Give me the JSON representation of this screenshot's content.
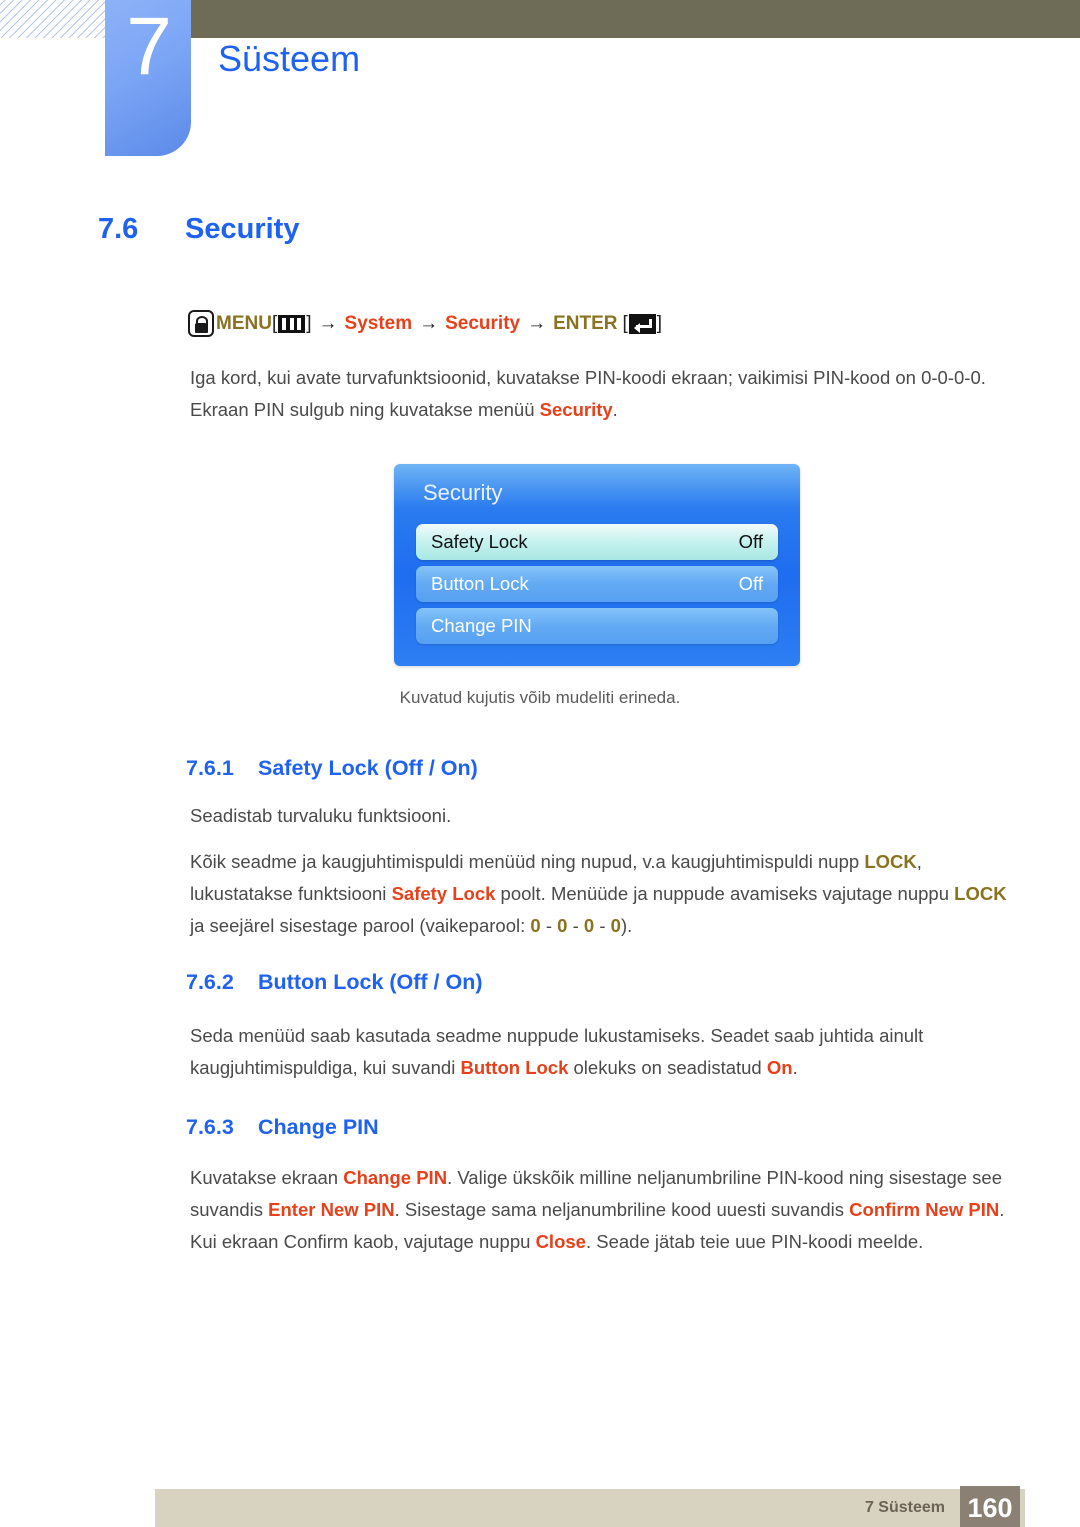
{
  "header": {
    "chapter_number": "7",
    "chapter_title": "Süsteem"
  },
  "section": {
    "number": "7.6",
    "title": "Security"
  },
  "menu_path": {
    "hand_icon": "hand-press-icon",
    "menu_label": "MENU",
    "bracket_open": "[",
    "menubars_icon": "menu-bars-icon",
    "bracket_close": "]",
    "arrow": "→",
    "step_system": "System",
    "step_security": "Security",
    "enter_label": "ENTER",
    "enter_icon": "enter-key-icon"
  },
  "intro": {
    "line1_part1": "Iga kord, kui avate turvafunktsioonid, kuvatakse PIN-koodi ekraan; vaikimisi PIN-kood on 0-0-0-0. Ekraan PIN sulgub ning kuvatakse menüü ",
    "line1_highlight": "Security",
    "line1_part2": "."
  },
  "osd": {
    "title": "Security",
    "rows": [
      {
        "label": "Safety Lock",
        "value": "Off",
        "selected": true
      },
      {
        "label": "Button Lock",
        "value": "Off",
        "selected": false
      },
      {
        "label": "Change PIN",
        "value": "",
        "selected": false
      }
    ]
  },
  "osd_caption": "Kuvatud kujutis võib mudeliti erineda.",
  "subsections": [
    {
      "number": "7.6.1",
      "title": "Safety Lock (Off / On)",
      "paragraphs": [
        {
          "text": "Seadistab turvaluku funktsiooni."
        }
      ],
      "long_paragraph": {
        "p1": "Kõik seadme ja kaugjuhtimispuldi menüüd ning nupud, v.a kaugjuhtimispuldi nupp ",
        "h1": "LOCK",
        "p2": ", lukustatakse funktsiooni ",
        "h2": "Safety Lock",
        "p3": " poolt. Menüüde ja nuppude avamiseks vajutage nuppu ",
        "h3": "LOCK",
        "p4": " ja seejärel sisestage parool (vaikeparool: ",
        "h4": "0",
        "p5": " - ",
        "h5": "0",
        "p6": " - ",
        "h6": "0",
        "p7": " - ",
        "h7": "0",
        "p8": ")."
      }
    },
    {
      "number": "7.6.2",
      "title": "Button Lock (Off / On)",
      "long_paragraph": {
        "p1": "Seda menüüd saab kasutada seadme nuppude lukustamiseks. Seadet saab juhtida ainult kaugjuhtimispuldiga, kui suvandi ",
        "h1": "Button Lock",
        "p2": " olekuks on seadistatud ",
        "h2": "On",
        "p3": "."
      }
    },
    {
      "number": "7.6.3",
      "title": "Change PIN",
      "long_paragraph": {
        "p1": "Kuvatakse ekraan ",
        "h1": "Change PIN",
        "p2": ". Valige ükskõik milline neljanumbriline PIN-kood ning sisestage see suvandis ",
        "h2": "Enter New PIN",
        "p3": ". Sisestage sama neljanumbriline kood uuesti suvandis ",
        "h3": "Confirm New PIN",
        "p4": ". Kui ekraan Confirm kaob, vajutage nuppu ",
        "h4": "Close",
        "p5": ". Seade jätab teie uue PIN-koodi meelde."
      }
    }
  ],
  "footer": {
    "chapter_label": "7 Süsteem",
    "page_number": "160"
  },
  "colors": {
    "accent_blue": "#1f62f0",
    "highlight_orange": "#e8401a",
    "highlight_gold": "#8a7320",
    "header_band": "#6e6b57",
    "footer_bar": "#d8d2c0",
    "footer_page_box": "#8a8073"
  }
}
